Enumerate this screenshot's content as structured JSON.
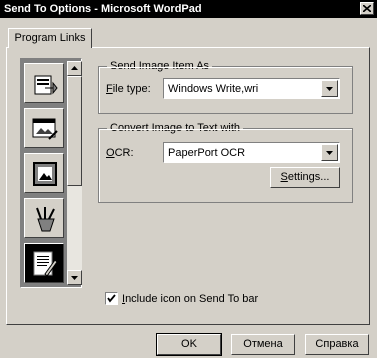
{
  "window": {
    "title": "Send To Options - Microsoft WordPad"
  },
  "tabs": [
    {
      "label": "Program Links"
    }
  ],
  "icons": [
    {
      "name": "clipboard-app-icon"
    },
    {
      "name": "image-editor-app-icon"
    },
    {
      "name": "picture-viewer-app-icon"
    },
    {
      "name": "paint-brushes-app-icon"
    },
    {
      "name": "wordpad-document-icon",
      "selected": true
    }
  ],
  "send_image": {
    "legend": "Send Image Item As",
    "file_type_label": "File type:",
    "file_type_value": "Windows Write,wri"
  },
  "ocr": {
    "legend": "Convert Image to Text with",
    "ocr_label": "OCR:",
    "ocr_value": "PaperPort OCR",
    "settings_label": "Settings..."
  },
  "include_icon": {
    "label": "Include icon on Send To bar",
    "checked": true
  },
  "buttons": {
    "ok": "OK",
    "cancel": "Отмена",
    "help": "Справка"
  }
}
